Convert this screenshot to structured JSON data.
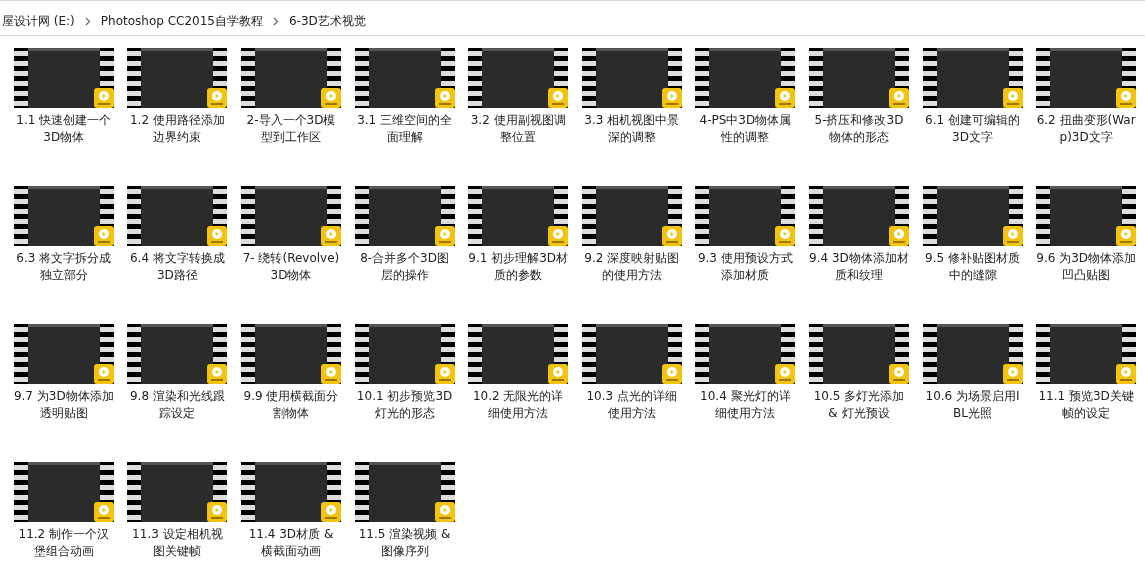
{
  "breadcrumb": [
    "屋设计网 (E:)",
    "Photoshop CC2015自学教程",
    "6-3D艺术视觉"
  ],
  "files": [
    {
      "name": "1.1 快速创建一个3D物体"
    },
    {
      "name": "1.2 使用路径添加边界约束"
    },
    {
      "name": "2-导入一个3D模型到工作区"
    },
    {
      "name": "3.1 三维空间的全面理解"
    },
    {
      "name": "3.2 使用副视图调整位置"
    },
    {
      "name": "3.3 相机视图中景深的调整"
    },
    {
      "name": "4-PS中3D物体属性的调整"
    },
    {
      "name": "5-挤压和修改3D物体的形态"
    },
    {
      "name": "6.1 创建可编辑的3D文字"
    },
    {
      "name": "6.2 扭曲变形(Warp)3D文字"
    },
    {
      "name": "6.3 将文字拆分成独立部分"
    },
    {
      "name": "6.4 将文字转换成3D路径"
    },
    {
      "name": "7- 绕转(Revolve)3D物体"
    },
    {
      "name": "8-合并多个3D图层的操作"
    },
    {
      "name": "9.1 初步理解3D材质的参数"
    },
    {
      "name": "9.2 深度映射贴图的使用方法"
    },
    {
      "name": "9.3 使用预设方式添加材质"
    },
    {
      "name": "9.4 3D物体添加材质和纹理"
    },
    {
      "name": "9.5 修补贴图材质中的缝隙"
    },
    {
      "name": "9.6 为3D物体添加凹凸贴图"
    },
    {
      "name": "9.7 为3D物体添加透明贴图"
    },
    {
      "name": "9.8 渲染和光线跟踪设定"
    },
    {
      "name": "9.9 使用横截面分割物体"
    },
    {
      "name": "10.1 初步预览3D灯光的形态"
    },
    {
      "name": "10.2 无限光的详细使用方法"
    },
    {
      "name": "10.3 点光的详细使用方法"
    },
    {
      "name": "10.4 聚光灯的详细使用方法"
    },
    {
      "name": "10.5 多灯光添加 & 灯光预设"
    },
    {
      "name": "10.6 为场景启用IBL光照"
    },
    {
      "name": "11.1 预览3D关键帧的设定"
    },
    {
      "name": "11.2 制作一个汉堡组合动画"
    },
    {
      "name": "11.3 设定相机视图关键帧"
    },
    {
      "name": "11.4 3D材质 & 横截面动画"
    },
    {
      "name": "11.5 渲染视频 & 图像序列"
    }
  ]
}
